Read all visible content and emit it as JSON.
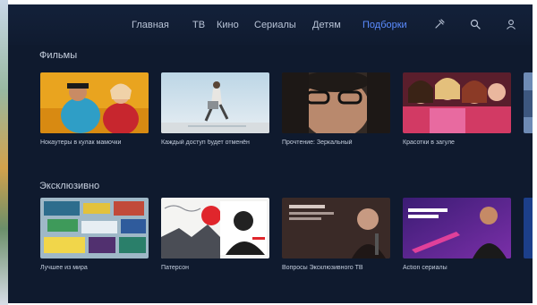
{
  "nav": {
    "items": [
      {
        "label": "Главная",
        "active": false
      },
      {
        "label": "ТВ",
        "active": false
      },
      {
        "label": "Кино",
        "active": false
      },
      {
        "label": "Сериалы",
        "active": false
      },
      {
        "label": "Детям",
        "active": false
      },
      {
        "label": "Подборки",
        "active": true
      }
    ],
    "icons": [
      "tools-icon",
      "search-icon",
      "profile-icon"
    ],
    "active_color": "#5b8cff"
  },
  "sections": [
    {
      "title": "Фильмы",
      "cards": [
        {
          "title": "Нокаутеры в кулак мамочки"
        },
        {
          "title": "Каждый доступ будет отменён"
        },
        {
          "title": "Прочтение: Зеркальный"
        },
        {
          "title": "Красотки в загуле"
        }
      ]
    },
    {
      "title": "Эксклюзивно",
      "cards": [
        {
          "title": "Лучшее из мира"
        },
        {
          "title": "Патерсон"
        },
        {
          "title": "Вопросы Эксклюзивного ТВ"
        },
        {
          "title": "Action сериалы"
        }
      ]
    }
  ]
}
